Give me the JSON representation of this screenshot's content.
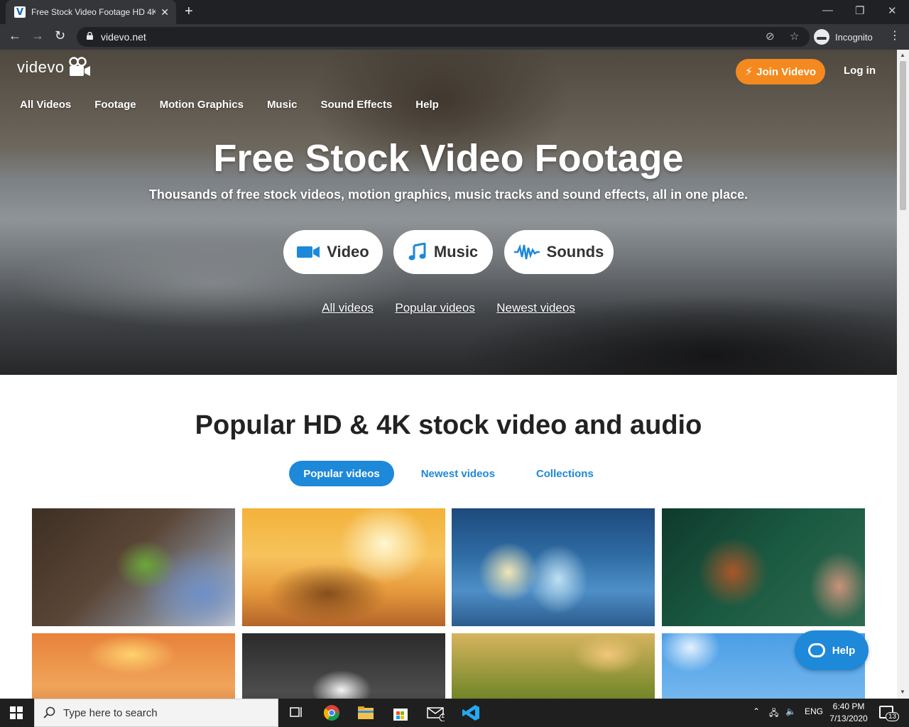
{
  "browser": {
    "tab_title": "Free Stock Video Footage HD 4K",
    "tab_favicon_letter": "V",
    "url": "videvo.net",
    "incognito_label": "Incognito"
  },
  "site": {
    "logo_text": "videvo",
    "join_label": "Join Videvo",
    "login_label": "Log in",
    "nav": [
      "All Videos",
      "Footage",
      "Motion Graphics",
      "Music",
      "Sound Effects",
      "Help"
    ],
    "hero_title": "Free Stock Video Footage",
    "hero_subtitle": "Thousands of free stock videos, motion graphics, music tracks and sound effects, all in one place.",
    "categories": [
      {
        "label": "Video",
        "icon": "video-camera-icon",
        "color": "#1e88d9"
      },
      {
        "label": "Music",
        "icon": "music-note-icon",
        "color": "#1e88d9"
      },
      {
        "label": "Sounds",
        "icon": "waveform-icon",
        "color": "#1e88d9"
      }
    ],
    "hero_links": [
      "All videos",
      "Popular videos",
      "Newest videos"
    ],
    "section_title": "Popular HD & 4K stock video and audio",
    "tabs": [
      "Popular videos",
      "Newest videos",
      "Collections"
    ],
    "active_tab": "Popular videos",
    "help_label": "Help",
    "accent_color": "#1e88d9",
    "join_color": "#f48a1f"
  },
  "taskbar": {
    "search_placeholder": "Type here to search",
    "language": "ENG",
    "time": "6:40 PM",
    "date": "7/13/2020",
    "notification_count": "13",
    "mail_badge": "1"
  }
}
